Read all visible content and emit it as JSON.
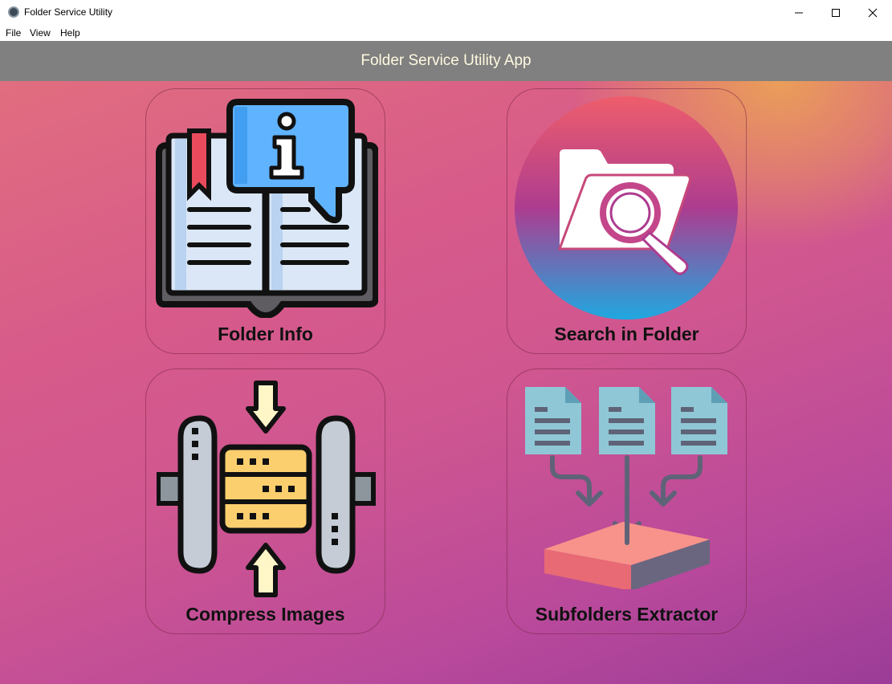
{
  "window": {
    "title": "Folder Service Utility"
  },
  "menu": {
    "items": [
      "File",
      "View",
      "Help"
    ]
  },
  "header": {
    "title": "Folder Service Utility App"
  },
  "cards": [
    {
      "label": "Folder Info",
      "icon": "open-book-info-icon"
    },
    {
      "label": "Search in Folder",
      "icon": "folder-search-icon"
    },
    {
      "label": "Compress Images",
      "icon": "compress-icon"
    },
    {
      "label": "Subfolders Extractor",
      "icon": "subfolders-extract-icon"
    }
  ]
}
